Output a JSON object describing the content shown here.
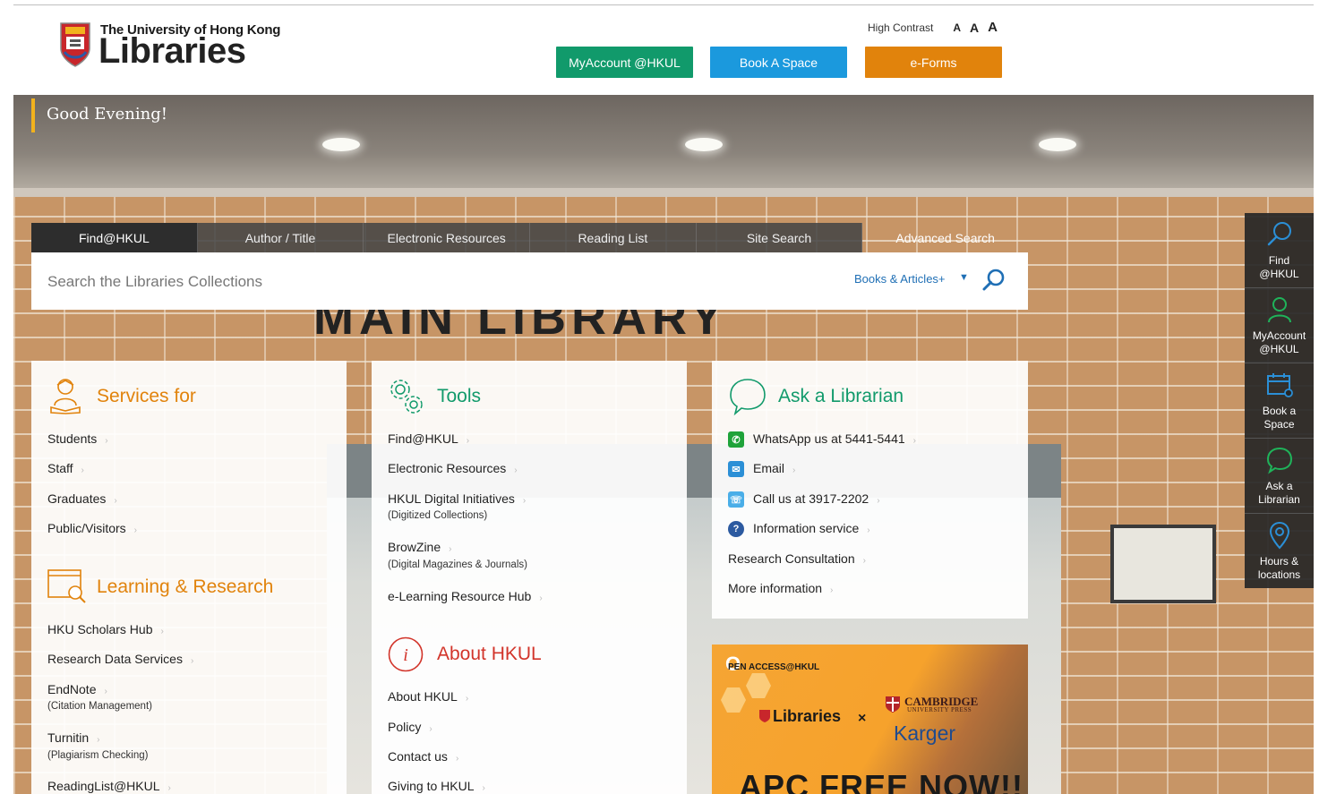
{
  "header": {
    "logo_line1": "The University of Hong Kong",
    "logo_line2": "Libraries",
    "high_contrast": "High Contrast",
    "font_sizes": [
      "A",
      "A",
      "A"
    ],
    "buttons": {
      "myaccount": "MyAccount @HKUL",
      "bookspace": "Book A Space",
      "eforms": "e-Forms"
    }
  },
  "hero": {
    "greeting": "Good Evening!",
    "sign": "MAIN LIBRARY"
  },
  "search": {
    "tabs": [
      "Find@HKUL",
      "Author / Title",
      "Electronic Resources",
      "Reading List",
      "Site Search"
    ],
    "advanced": "Advanced Search",
    "placeholder": "Search the Libraries Collections",
    "scope": "Books & Articles+"
  },
  "services": {
    "title": "Services for",
    "links": [
      "Students",
      "Staff",
      "Graduates",
      "Public/Visitors"
    ]
  },
  "learning": {
    "title": "Learning & Research",
    "links": [
      {
        "label": "HKU Scholars Hub"
      },
      {
        "label": "Research Data Services"
      },
      {
        "label": "EndNote",
        "sub": "(Citation Management)"
      },
      {
        "label": "Turnitin",
        "sub": "(Plagiarism Checking)"
      },
      {
        "label": "ReadingList@HKUL"
      }
    ]
  },
  "tools": {
    "title": "Tools",
    "links": [
      {
        "label": "Find@HKUL"
      },
      {
        "label": "Electronic Resources"
      },
      {
        "label": "HKUL Digital Initiatives",
        "sub": "(Digitized Collections)"
      },
      {
        "label": "BrowZine",
        "sub": "(Digital Magazines & Journals)"
      },
      {
        "label": "e-Learning Resource Hub"
      }
    ]
  },
  "about": {
    "title": "About HKUL",
    "links": [
      "About HKUL",
      "Policy",
      "Contact us",
      "Giving to HKUL"
    ]
  },
  "ask": {
    "title": "Ask a Librarian",
    "links": [
      "WhatsApp us at 5441-5441",
      "Email",
      "Call us at 3917-2202",
      "Information service",
      "Research Consultation",
      "More information"
    ]
  },
  "banner": {
    "oa": "PEN ACCESS@HKUL",
    "oa_letter": "O",
    "lib": "Libraries",
    "x": "×",
    "cambridge": "CAMBRIDGE",
    "cambridge_sub": "UNIVERSITY PRESS",
    "karger": "Karger",
    "apc": "APC FREE NOW!!"
  },
  "dock": [
    "Find @HKUL",
    "MyAccount @HKUL",
    "Book a Space",
    "Ask a Librarian",
    "Hours & locations"
  ],
  "colors": {
    "orange": "#e1830c",
    "green": "#119a6b",
    "blue": "#1b99dd",
    "yellow": "#f2b21d"
  }
}
